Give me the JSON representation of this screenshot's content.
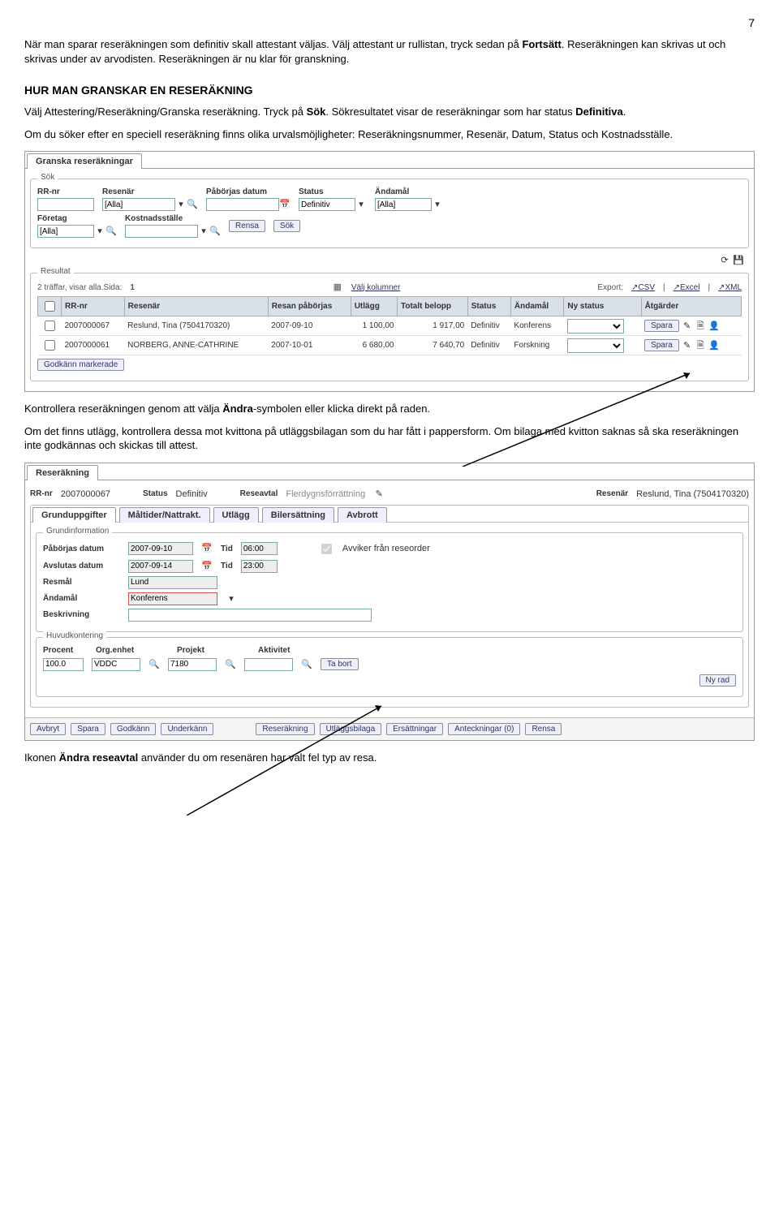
{
  "page_number": "7",
  "para1_a": "När man sparar reseräkningen som definitiv skall attestant väljas. Välj attestant ur rullistan, tryck sedan på ",
  "para1_b": "Fortsätt",
  "para1_c": ". Reseräkningen kan skrivas ut och skrivas under av arvodisten. Reseräkningen är nu klar för granskning.",
  "heading1": "HUR MAN GRANSKAR EN RESERÄKNING",
  "para2_a": "Välj Attestering/Reseräkning/Granska reseräkning. Tryck på ",
  "para2_b": "Sök",
  "para2_c": ". Sökresultatet visar de reseräkningar som har status ",
  "para2_d": "Definitiva",
  "para2_e": ".",
  "para3": "Om du söker efter en speciell reseräkning finns olika urvalsmöjligheter: Reseräkningsnummer, Resenär, Datum, Status och Kostnadsställe.",
  "panel1": {
    "tab": "Granska reseräkningar",
    "search_legend": "Sök",
    "lbl_rr": "RR-nr",
    "lbl_resenar": "Resenär",
    "lbl_date": "Påbörjas datum",
    "lbl_status": "Status",
    "lbl_andamal": "Ändamål",
    "lbl_foretag": "Företag",
    "lbl_kostnad": "Kostnadsställe",
    "resenar_val": "[Alla]",
    "status_val": "Definitiv",
    "andamal_val": "[Alla]",
    "foretag_val": "[Alla]",
    "btn_rensa": "Rensa",
    "btn_sok": "Sök",
    "result_legend": "Resultat",
    "result_info": "2 träffar, visar alla.Sida:",
    "page": "1",
    "valj_kol": "Välj kolumner",
    "export": "Export:",
    "csv": "CSV",
    "excel": "Excel",
    "xml": "XML",
    "cols": [
      "RR-nr",
      "Resenär",
      "Resan påbörjas",
      "Utlägg",
      "Totalt belopp",
      "Status",
      "Ändamål",
      "Ny status",
      "Åtgärder"
    ],
    "rows": [
      {
        "rr": "2007000067",
        "res": "Reslund, Tina (7504170320)",
        "start": "2007-09-10",
        "utlagg": "1 100,00",
        "tot": "1 917,00",
        "status": "Definitiv",
        "andamal": "Konferens",
        "spara": "Spara"
      },
      {
        "rr": "2007000061",
        "res": "NORBERG, ANNE-CATHRINE",
        "start": "2007-10-01",
        "utlagg": "6 680,00",
        "tot": "7 640,70",
        "status": "Definitiv",
        "andamal": "Forskning",
        "spara": "Spara"
      }
    ],
    "btn_godkann": "Godkänn markerade"
  },
  "para4_a": "Kontrollera reseräkningen genom att välja ",
  "para4_b": "Ändra",
  "para4_c": "-symbolen eller klicka direkt på raden.",
  "para5": "Om det finns utlägg, kontrollera dessa mot kvittona på utläggsbilagan som du har fått i pappersform. Om bilaga med kvitton saknas så ska reseräkningen inte godkännas och skickas till attest.",
  "panel2": {
    "tab": "Reseräkning",
    "lbl_rrnr": "RR-nr",
    "rrnr": "2007000067",
    "lbl_status": "Status",
    "status": "Definitiv",
    "lbl_reseavtal": "Reseavtal",
    "reseavtal": "Flerdygnsförrättning",
    "lbl_resenar": "Resenär",
    "resenar": "Reslund, Tina (7504170320)",
    "tabs": [
      "Grunduppgifter",
      "Måltider/Nattrakt.",
      "Utlägg",
      "Bilersättning",
      "Avbrott"
    ],
    "gi_legend": "Grundinformation",
    "lbl_start": "Påbörjas datum",
    "start": "2007-09-10",
    "lbl_tid": "Tid",
    "tid1": "06:00",
    "lbl_end": "Avslutas datum",
    "end": "2007-09-14",
    "tid2": "23:00",
    "lbl_avviker": "Avviker från reseorder",
    "lbl_resmal": "Resmål",
    "resmal": "Lund",
    "lbl_andamal": "Ändamål",
    "andamal": "Konferens",
    "lbl_beskr": "Beskrivning",
    "hk_legend": "Huvudkontering",
    "cols": [
      "Procent",
      "Org.enhet",
      "Projekt",
      "Aktivitet"
    ],
    "procent": "100.0",
    "org": "VDDC",
    "projekt": "7180",
    "aktivitet": "",
    "btn_tabort": "Ta bort",
    "btn_nyrad": "Ny rad",
    "btns": [
      "Avbryt",
      "Spara",
      "Godkänn",
      "Underkänn",
      "Reseräkning",
      "Utläggsbilaga",
      "Ersättningar",
      "Anteckningar (0)",
      "Rensa"
    ]
  },
  "para6_a": "Ikonen ",
  "para6_b": "Ändra reseavtal",
  "para6_c": " använder du om resenären har valt fel typ av resa."
}
